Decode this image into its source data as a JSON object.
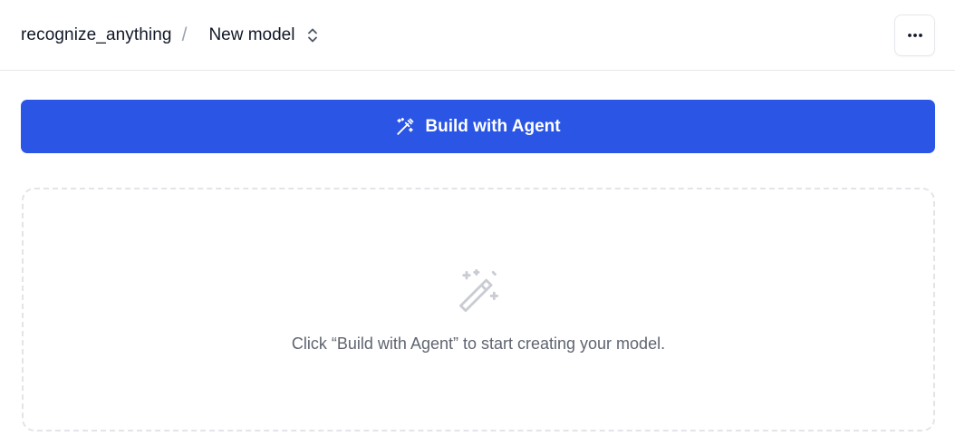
{
  "header": {
    "project_name": "recognize_anything",
    "separator": "/",
    "model_name": "New model",
    "model_selector_icon": "chevron-up-down-icon",
    "more_icon": "ellipsis-horizontal-icon"
  },
  "toolbar": {
    "build_label": "Build with Agent",
    "build_icon": "magic-wand-icon"
  },
  "empty_state": {
    "icon": "magic-wand-icon",
    "message": "Click “Build with Agent” to start creating your model."
  },
  "colors": {
    "accent": "#2a55e5",
    "border": "#e5e7eb",
    "muted_text": "#5f6470",
    "icon_muted": "#c9ccd2"
  }
}
